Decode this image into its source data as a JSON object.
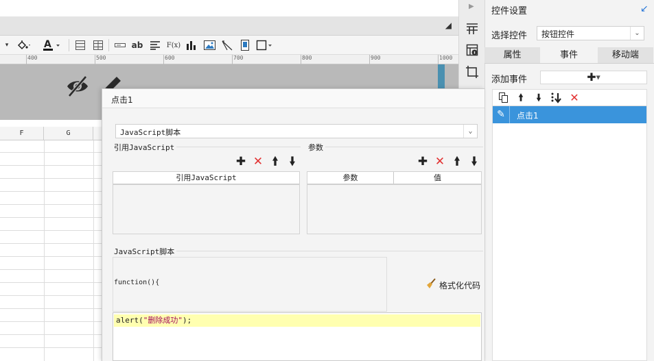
{
  "ruler": {
    "labels": [
      "400",
      "500",
      "600",
      "700",
      "800",
      "900",
      "1000"
    ]
  },
  "sheet": {
    "columns": [
      "F",
      "G"
    ]
  },
  "toolbar": {
    "text_icon_ab": "ab",
    "formula_icon": "F(x)"
  },
  "right_panel": {
    "title": "控件设置",
    "select_label": "选择控件",
    "select_value": "按钮控件",
    "tabs": [
      "属性",
      "事件",
      "移动端"
    ],
    "active_tab": "事件",
    "add_event_label": "添加事件",
    "events": [
      {
        "label": "点击1"
      }
    ],
    "accent_color": "#3a94dc"
  },
  "dialog": {
    "title": "点击1",
    "type_select": "JavaScript脚本",
    "ref_js": {
      "label": "引用JavaScript",
      "column": "引用JavaScript"
    },
    "params": {
      "label": "参数",
      "columns": [
        "参数",
        "值"
      ]
    },
    "script": {
      "label": "JavaScript脚本",
      "function_header": "function(){",
      "format_button": "格式化代码",
      "code_prefix": "alert(",
      "code_string": "\"删除成功\"",
      "code_suffix": ");"
    }
  }
}
